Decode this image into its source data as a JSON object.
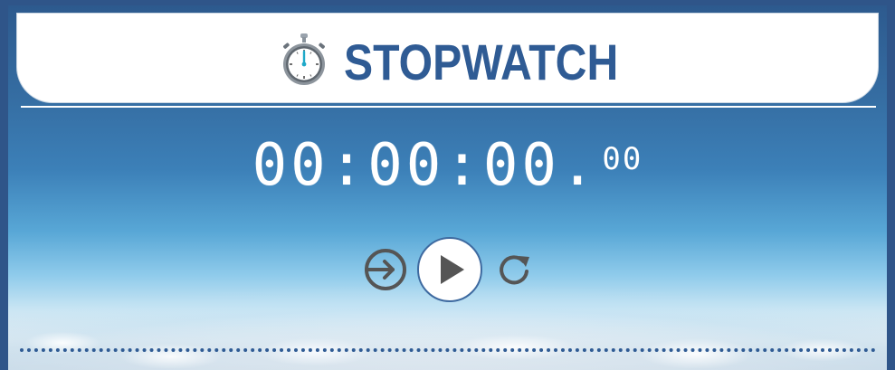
{
  "header": {
    "title": "STOPWATCH",
    "icon": "stopwatch-icon"
  },
  "display": {
    "time_main": "00:00:00.",
    "time_fraction": "00"
  },
  "controls": {
    "lap_icon": "lap-icon",
    "play_icon": "play-icon",
    "reset_icon": "reset-icon"
  },
  "colors": {
    "brand": "#2f5b94",
    "frame": "#2f5589",
    "control_gray": "#555555",
    "digit": "#ffffff"
  }
}
